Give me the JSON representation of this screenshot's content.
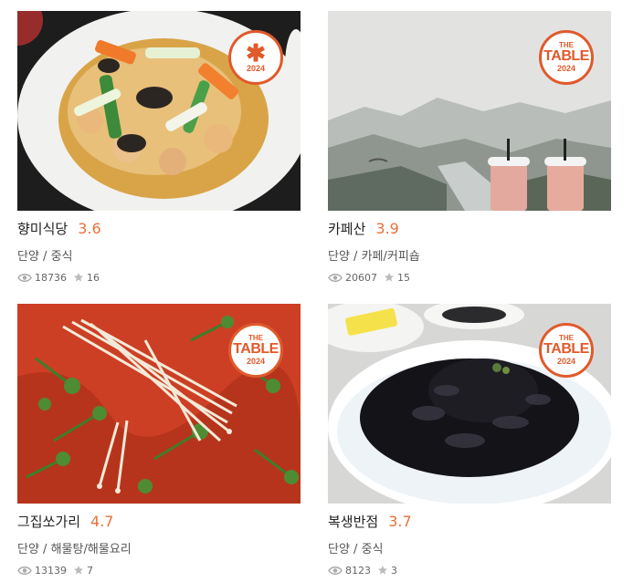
{
  "restaurants": [
    {
      "name": "향미식당",
      "rating": "3.6",
      "category": "단양 / 중식",
      "views": "18736",
      "stars": "16",
      "badge": {
        "type": "icon",
        "year": "2024"
      }
    },
    {
      "name": "카페산",
      "rating": "3.9",
      "category": "단양 / 카페/커피숍",
      "views": "20607",
      "stars": "15",
      "badge": {
        "type": "text",
        "the": "THE",
        "table": "TABLE",
        "year": "2024"
      }
    },
    {
      "name": "그집쏘가리",
      "rating": "4.7",
      "category": "단양 / 해물탕/해물요리",
      "views": "13139",
      "stars": "7",
      "badge": {
        "type": "text",
        "the": "THE",
        "table": "TABLE",
        "year": "2024"
      }
    },
    {
      "name": "복생반점",
      "rating": "3.7",
      "category": "단양 / 중식",
      "views": "8123",
      "stars": "3",
      "badge": {
        "type": "text",
        "the": "THE",
        "table": "TABLE",
        "year": "2024"
      }
    }
  ],
  "colors": {
    "accent": "#e8703a",
    "badge": "#e05a2b"
  },
  "icons": {
    "views": "eye-icon",
    "stars": "star-icon",
    "badge_mark": "asterisk-icon"
  }
}
